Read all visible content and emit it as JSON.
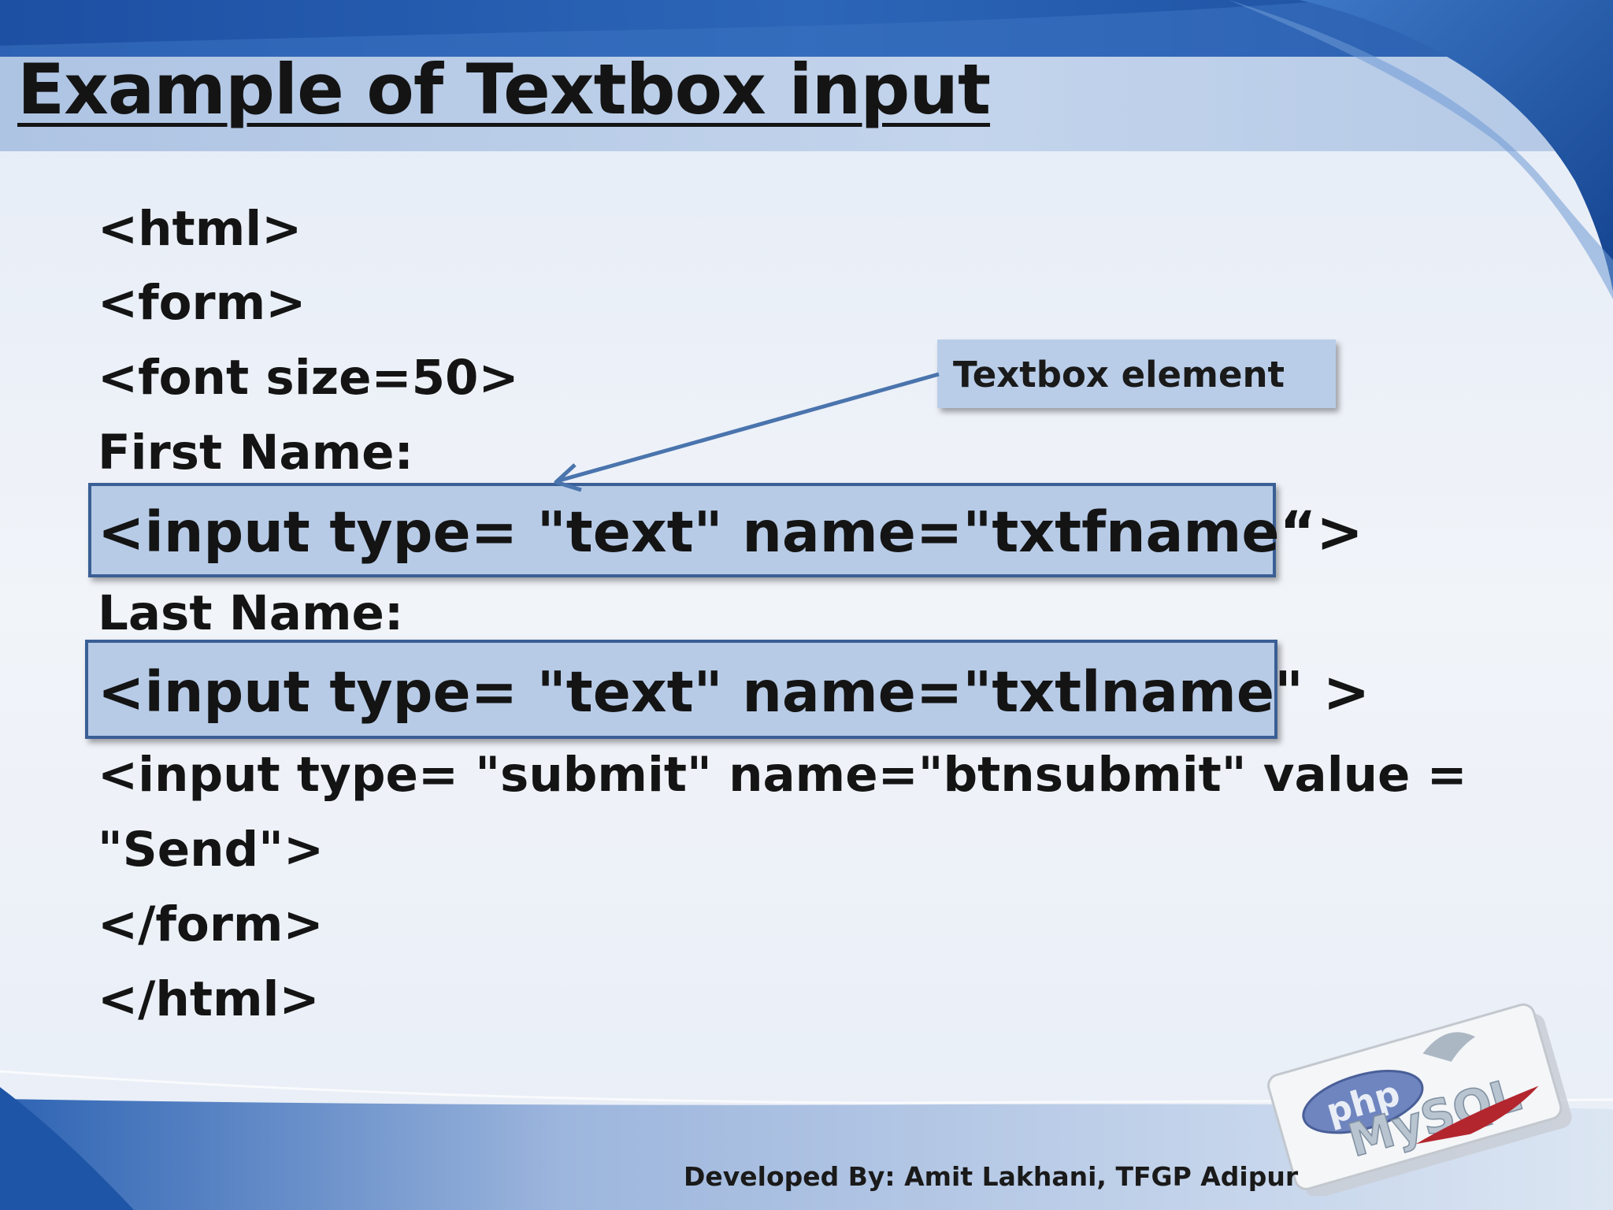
{
  "slide": {
    "title": "Example of Textbox input",
    "code_lines": [
      "<html>",
      "<form>",
      "<font size=50>",
      "First Name:",
      "<input type= \"text\" name=\"txtfname“>",
      "Last Name:",
      "<input type= \"text\" name=\"txtlname\" >",
      "<input type= \"submit\" name=\"btnsubmit\" value =",
      "\"Send\">",
      "</form>",
      "</html>"
    ],
    "callout": "Textbox element",
    "footer": "Developed By: Amit Lakhani, TFGP Adipur",
    "logo_text": [
      "php",
      "MySQL"
    ]
  },
  "colors": {
    "accent_blue": "#2b5ea8",
    "highlight_fill": "#b7cbe7",
    "highlight_border": "#3a5f95",
    "callout_fill": "#b9cde9",
    "arrow": "#4a74ad"
  }
}
